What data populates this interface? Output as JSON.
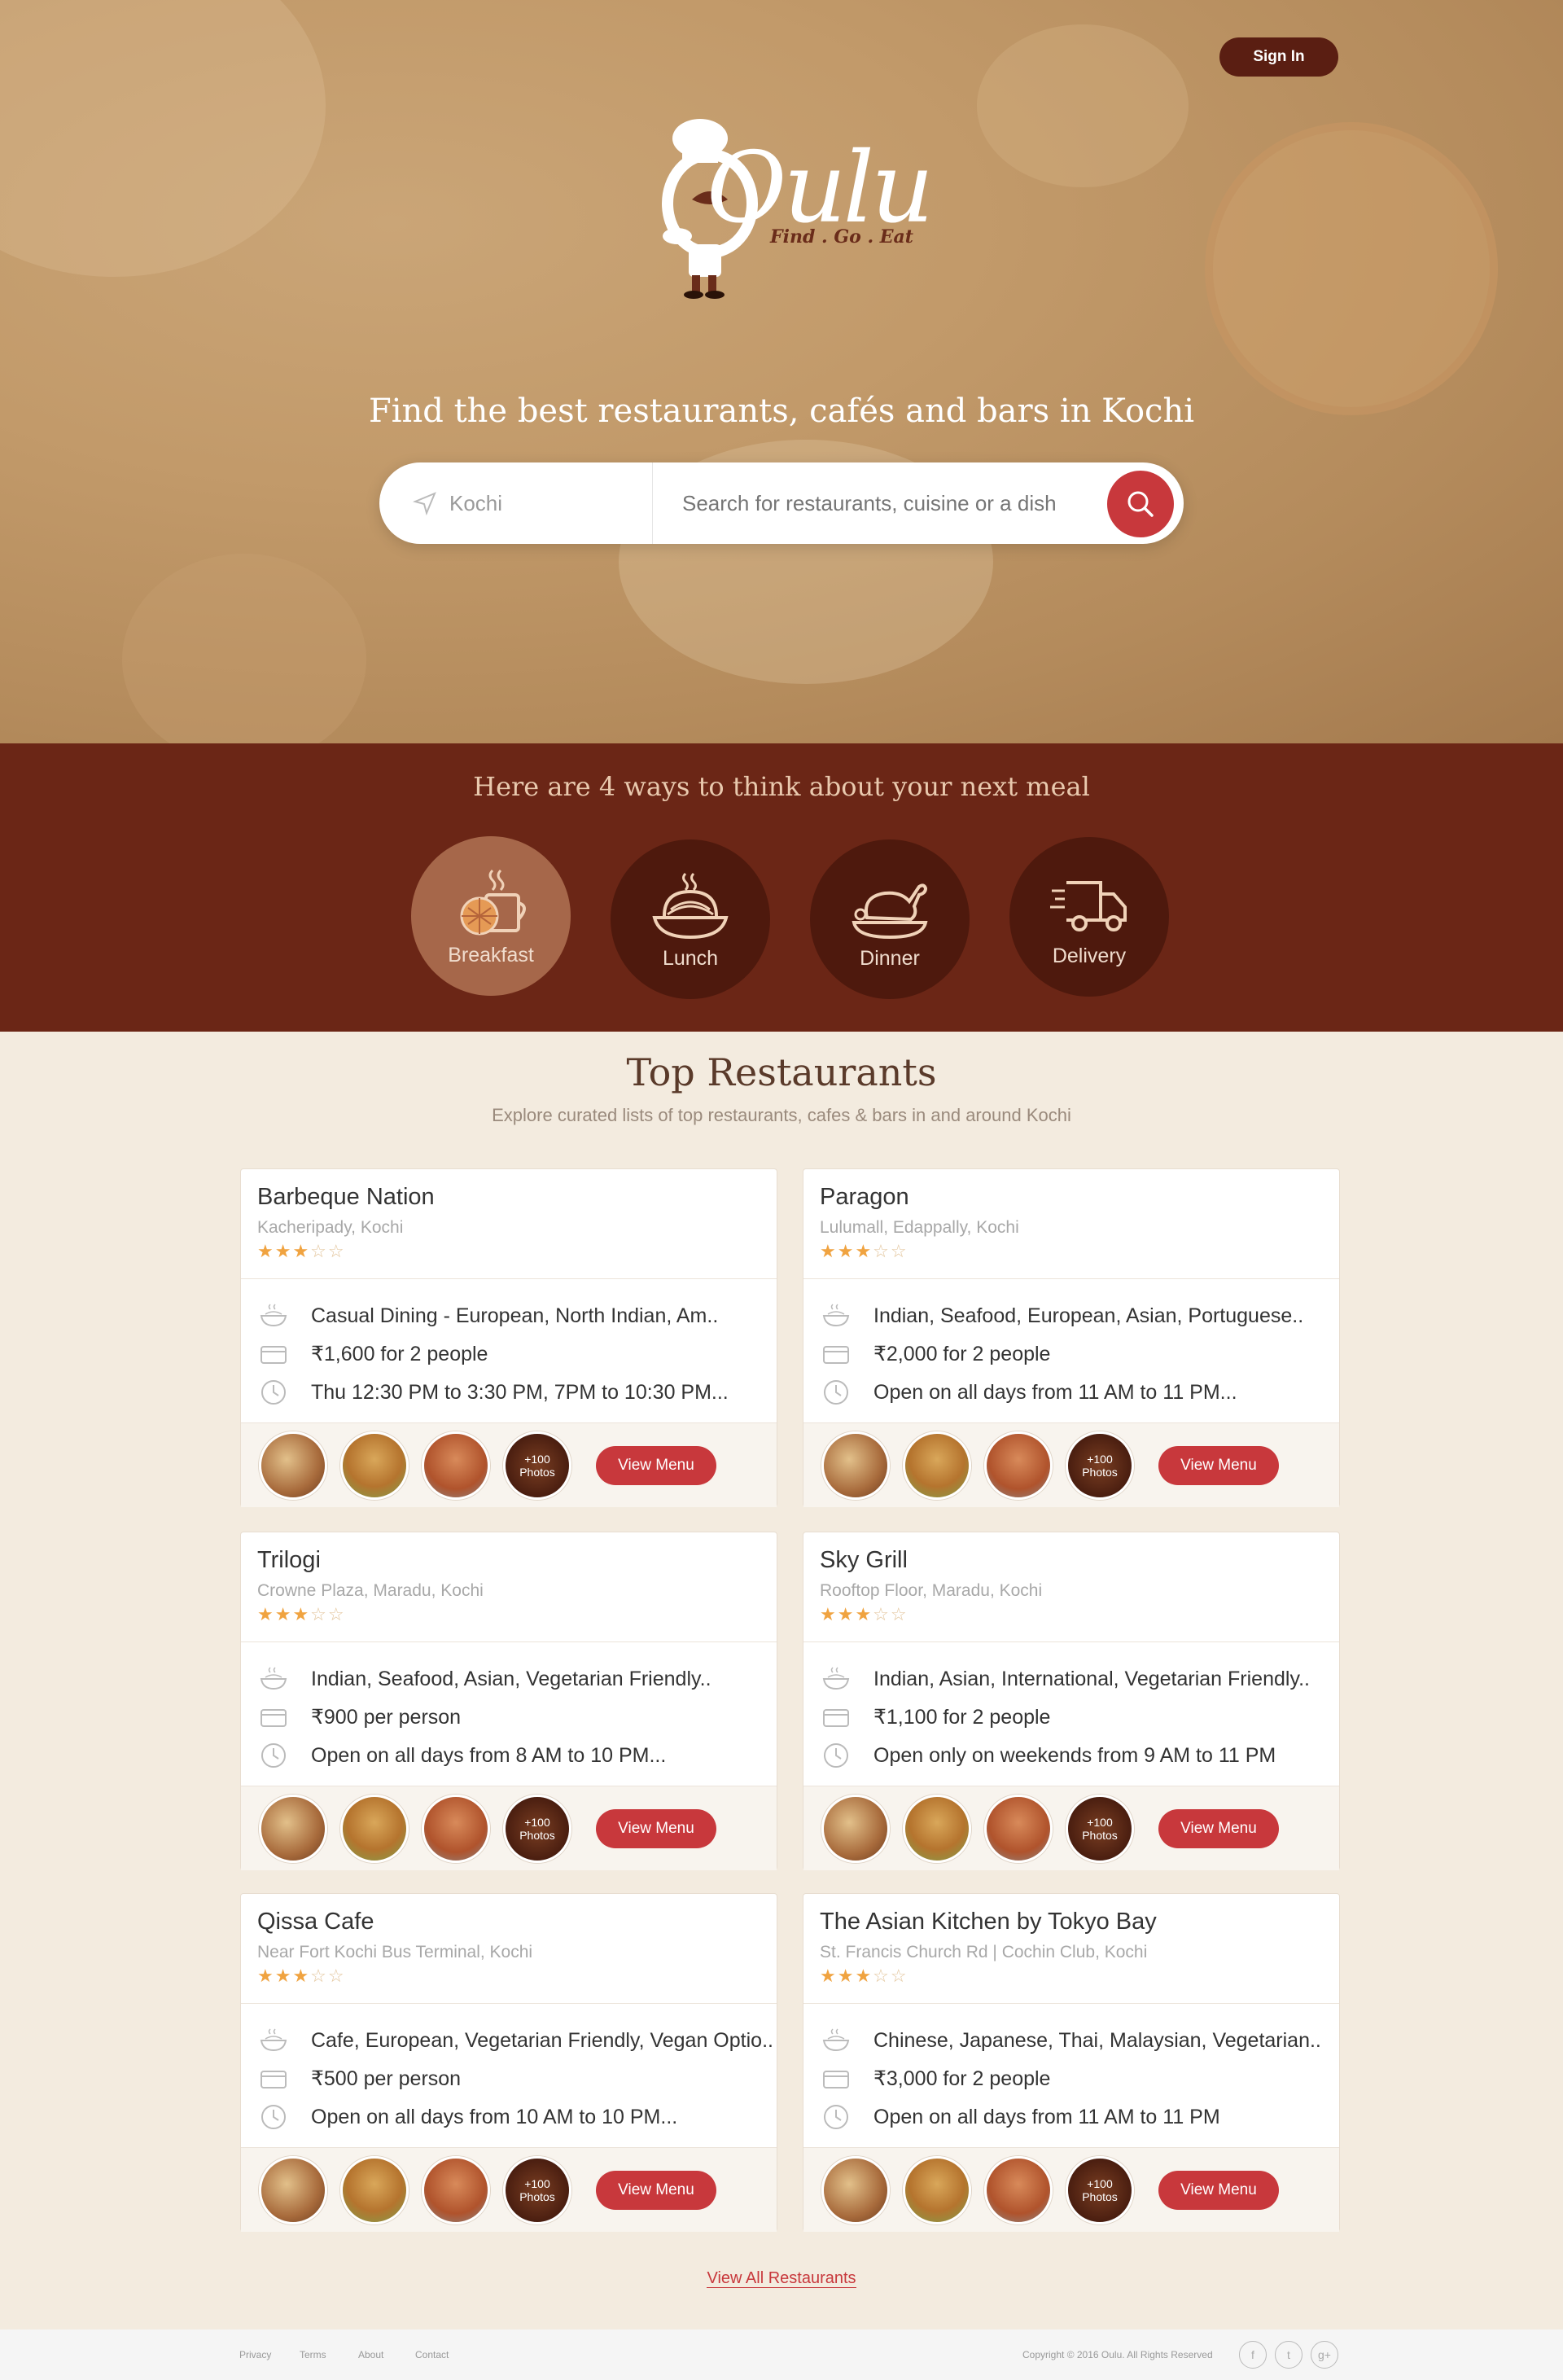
{
  "header": {
    "signin_label": "Sign In",
    "logo_word": "Oulu",
    "logo_tagline": "Find . Go . Eat",
    "title": "Find the best restaurants, cafés and bars in Kochi"
  },
  "search": {
    "location_value": "Kochi",
    "query_placeholder": "Search for restaurants, cuisine or a dish"
  },
  "ways": {
    "title": "Here are 4 ways to think about your next meal",
    "items": [
      {
        "label": "Breakfast",
        "icon": "coffee-waffle-icon",
        "active": true
      },
      {
        "label": "Lunch",
        "icon": "noodle-bowl-icon",
        "active": false
      },
      {
        "label": "Dinner",
        "icon": "roast-chicken-icon",
        "active": false
      },
      {
        "label": "Delivery",
        "icon": "delivery-truck-icon",
        "active": false
      }
    ]
  },
  "top": {
    "title": "Top Restaurants",
    "subtitle": "Explore curated lists of top restaurants, cafes & bars in and around Kochi",
    "view_all": "View All Restaurants",
    "photos_badge": [
      "+100",
      "Photos"
    ],
    "view_menu": "View Menu",
    "restaurants": [
      {
        "name": "Barbeque Nation",
        "location": "Kacheripady, Kochi",
        "rating": 3,
        "cuisine": "Casual Dining - European, North Indian, Am..",
        "cost": "₹1,600 for 2 people",
        "hours": "Thu 12:30 PM to 3:30 PM, 7PM to 10:30 PM..."
      },
      {
        "name": "Paragon",
        "location": "Lulumall, Edappally, Kochi",
        "rating": 3,
        "cuisine": "Indian, Seafood, European, Asian, Portuguese..",
        "cost": "₹2,000 for 2 people",
        "hours": "Open on all days from 11 AM to 11 PM..."
      },
      {
        "name": "Trilogi",
        "location": "Crowne Plaza, Maradu, Kochi",
        "rating": 3,
        "cuisine": "Indian, Seafood, Asian, Vegetarian Friendly..",
        "cost": "₹900 per person",
        "hours": "Open on all days from 8 AM to 10 PM..."
      },
      {
        "name": "Sky Grill",
        "location": "Rooftop Floor, Maradu, Kochi",
        "rating": 3,
        "cuisine": "Indian, Asian, International, Vegetarian Friendly..",
        "cost": "₹1,100 for 2 people",
        "hours": "Open only on weekends from 9 AM to 11 PM"
      },
      {
        "name": "Qissa Cafe",
        "location": "Near Fort Kochi Bus Terminal, Kochi",
        "rating": 3,
        "cuisine": "Cafe, European, Vegetarian Friendly, Vegan Optio..",
        "cost": "₹500 per person",
        "hours": "Open on all days from 10 AM to 10 PM..."
      },
      {
        "name": "The Asian Kitchen by Tokyo Bay",
        "location": "St. Francis Church Rd | Cochin Club, Kochi",
        "rating": 3,
        "cuisine": "Chinese, Japanese, Thai, Malaysian, Vegetarian..",
        "cost": "₹3,000 for 2 people",
        "hours": "Open on all days from 11 AM to 11 PM"
      }
    ]
  },
  "footer": {
    "links": [
      "Privacy",
      "Terms",
      "About",
      "Contact"
    ],
    "copyright": "Copyright © 2016 Oulu. All Rights Reserved",
    "social": [
      "facebook-icon",
      "twitter-icon",
      "google-plus-icon"
    ]
  },
  "colors": {
    "accent": "#c8383c",
    "brown": "#6b2616",
    "dark_brown": "#5a1e12",
    "cream": "#f3ebdf",
    "star": "#f0a340"
  }
}
